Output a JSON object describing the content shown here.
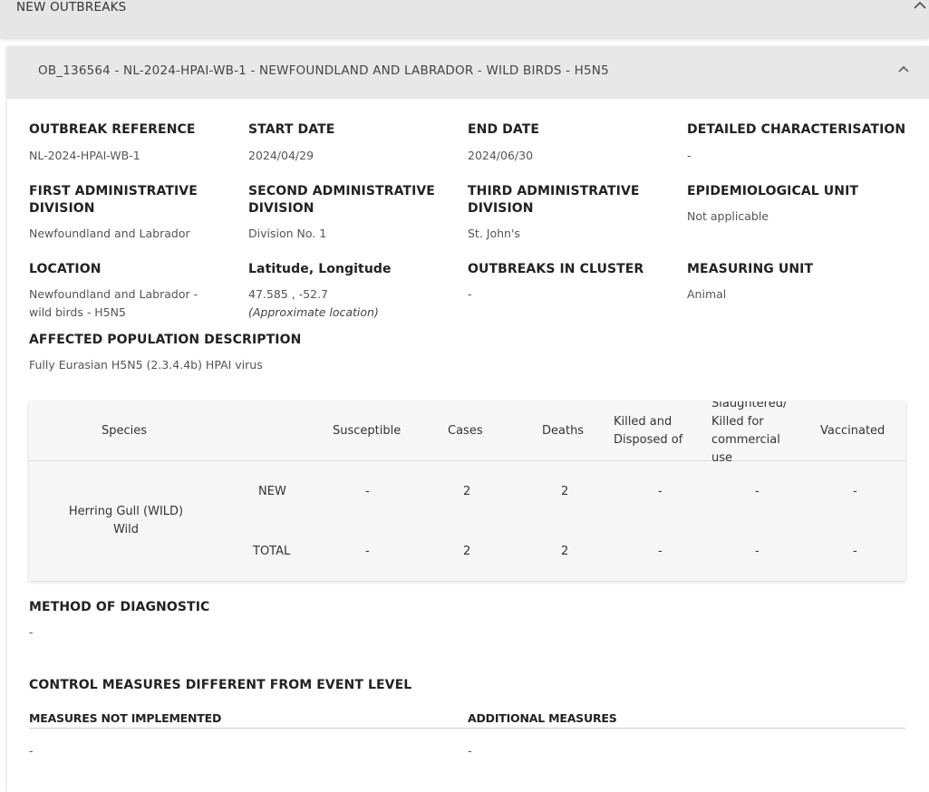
{
  "section_title": "NEW OUTBREAKS",
  "outbreak": {
    "header": "OB_136564 - NL-2024-HPAI-WB-1 - NEWFOUNDLAND AND LABRADOR - WILD BIRDS - H5N5",
    "fields": {
      "outbreak_reference": {
        "label": "OUTBREAK REFERENCE",
        "value": "NL-2024-HPAI-WB-1"
      },
      "start_date": {
        "label": "START DATE",
        "value": "2024/04/29"
      },
      "end_date": {
        "label": "END DATE",
        "value": "2024/06/30"
      },
      "detailed_characterisation": {
        "label": "DETAILED CHARACTERISATION",
        "value": "-"
      },
      "first_admin": {
        "label_line1": "FIRST ADMINISTRATIVE",
        "label_line2": "DIVISION",
        "value": "Newfoundland and Labrador"
      },
      "second_admin": {
        "label_line1": "SECOND ADMINISTRATIVE",
        "label_line2": "DIVISION",
        "value": "Division No. 1"
      },
      "third_admin": {
        "label_line1": "THIRD ADMINISTRATIVE",
        "label_line2": "DIVISION",
        "value": "St. John's"
      },
      "epidemiological_unit": {
        "label": "EPIDEMIOLOGICAL UNIT",
        "value": "Not applicable"
      },
      "location": {
        "label": "LOCATION",
        "value_line1": "Newfoundland and Labrador -",
        "value_line2": "wild birds - H5N5"
      },
      "lat_long": {
        "label": "Latitude, Longitude",
        "value": "47.585 , -52.7",
        "note": "(Approximate location)"
      },
      "outbreaks_in_cluster": {
        "label": "OUTBREAKS IN CLUSTER",
        "value": "-"
      },
      "measuring_unit": {
        "label": "MEASURING UNIT",
        "value": "Animal"
      },
      "affected_population": {
        "label": "AFFECTED POPULATION DESCRIPTION",
        "value": "Fully Eurasian H5N5 (2.3.4.4b) HPAI virus"
      }
    },
    "species_table": {
      "headers": {
        "species": "Species",
        "susceptible": "Susceptible",
        "cases": "Cases",
        "deaths": "Deaths",
        "killed_line1": "Killed and",
        "killed_line2": "Disposed of",
        "slaughtered_line1": "Slaughtered/",
        "slaughtered_line2": "Killed for",
        "slaughtered_line3": "commercial",
        "slaughtered_line4": "use",
        "vaccinated": "Vaccinated"
      },
      "species_name_line1": "Herring Gull (WILD)",
      "species_name_line2": "Wild",
      "rows": [
        {
          "type": "NEW",
          "susceptible": "-",
          "cases": "2",
          "deaths": "2",
          "killed": "-",
          "slaughtered": "-",
          "vaccinated": "-"
        },
        {
          "type": "TOTAL",
          "susceptible": "-",
          "cases": "2",
          "deaths": "2",
          "killed": "-",
          "slaughtered": "-",
          "vaccinated": "-"
        }
      ]
    },
    "method_of_diagnostic": {
      "label": "METHOD OF DIAGNOSTIC",
      "value": "-"
    },
    "control_measures": {
      "label": "CONTROL MEASURES DIFFERENT FROM EVENT LEVEL",
      "not_implemented": {
        "label": "MEASURES NOT IMPLEMENTED",
        "value": "-"
      },
      "additional": {
        "label": "ADDITIONAL MEASURES",
        "value": "-"
      }
    }
  }
}
